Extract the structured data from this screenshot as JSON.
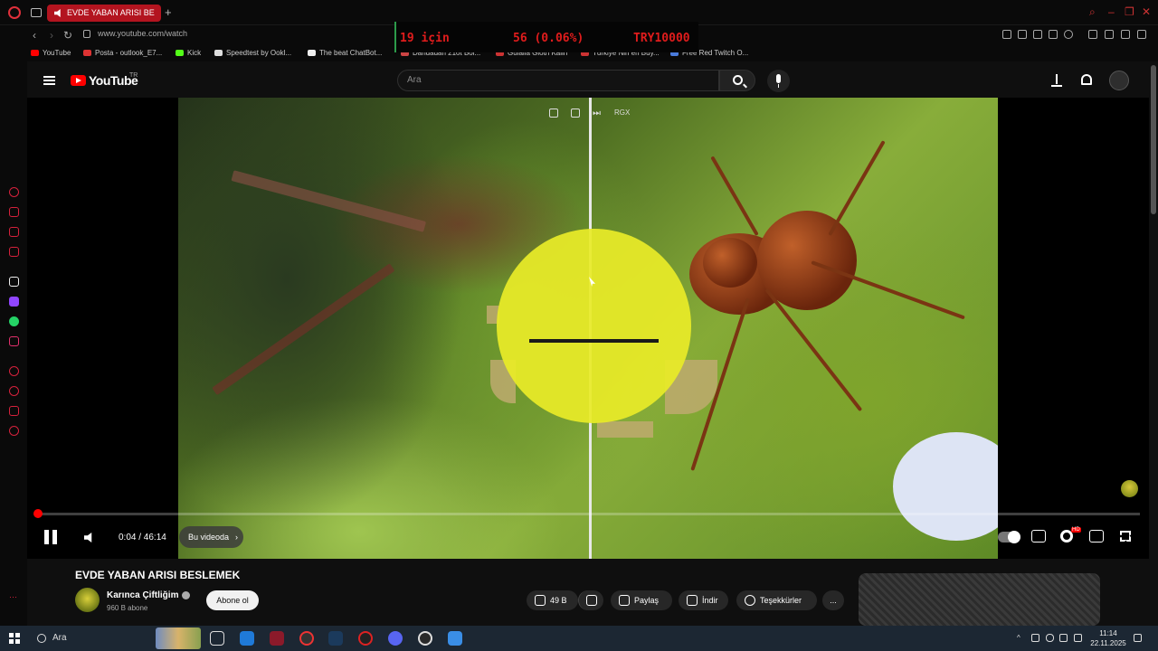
{
  "browser": {
    "tab_title": "EVDE YABAN ARISI BE",
    "url": "www.youtube.com/watch",
    "ticker": {
      "count": "19 için",
      "change": "56 (0.06%)",
      "amount": "TRY10000"
    },
    "bookmarks": [
      {
        "label": "YouTube",
        "color": "#ff0000"
      },
      {
        "label": "Posta - outlook_E7...",
        "color": "#d33"
      },
      {
        "label": "Kick",
        "color": "#53fc18"
      },
      {
        "label": "Speedtest by Ookl...",
        "color": "#ddd"
      },
      {
        "label": "The beat ChatBot...",
        "color": "#eee"
      },
      {
        "label": "Dandadan 21ot Bol...",
        "color": "#c44"
      },
      {
        "label": "Gulalla Gloth Kalin",
        "color": "#c33"
      },
      {
        "label": "Türkiye Nin en Buy...",
        "color": "#c33"
      },
      {
        "label": "Free Red Twitch O...",
        "color": "#4a7bdc"
      }
    ]
  },
  "youtube": {
    "logo_text": "YouTube",
    "country": "TR",
    "search_placeholder": "Ara",
    "overlay_controls": {
      "badge": "RGX"
    }
  },
  "player": {
    "current_time": "0:04",
    "duration": "46:14",
    "time_display": "0:04 / 46:14",
    "progress_fraction": 0.0014,
    "chapter_label": "Bu videoda",
    "quality_badge": "HD"
  },
  "video": {
    "title": "EVDE YABAN ARISI BESLEMEK",
    "channel": "Karınca Çiftliğim",
    "subscribers": "960 B abone",
    "subscribe_label": "Abone ol",
    "likes": "49 B",
    "share_label": "Paylaş",
    "download_label": "İndir",
    "thanks_label": "Teşekkürler",
    "more_label": "..."
  },
  "taskbar": {
    "search_placeholder": "Ara",
    "time": "11:14",
    "date": "22.11.2025"
  }
}
